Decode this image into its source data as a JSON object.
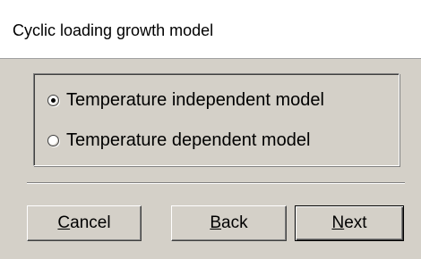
{
  "window": {
    "title": "Cyclic loading growth model"
  },
  "options": {
    "items": [
      {
        "label": "Temperature independent model",
        "checked": true
      },
      {
        "label": "Temperature dependent model",
        "checked": false
      }
    ]
  },
  "buttons": {
    "cancel": {
      "accel": "C",
      "rest": "ancel"
    },
    "back": {
      "accel": "B",
      "rest": "ack"
    },
    "next": {
      "accel": "N",
      "rest": "ext"
    }
  },
  "colors": {
    "dialog_bg": "#d4d0c8",
    "title_bg": "#ffffff"
  }
}
